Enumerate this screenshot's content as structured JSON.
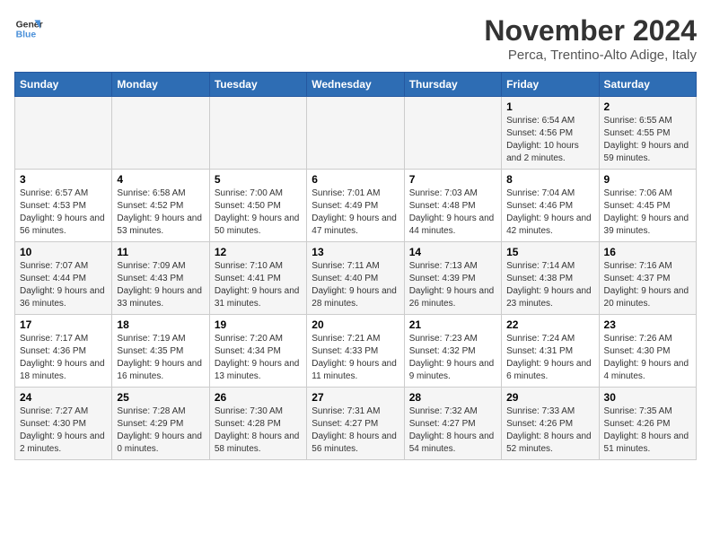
{
  "logo": {
    "line1": "General",
    "line2": "Blue"
  },
  "title": "November 2024",
  "location": "Perca, Trentino-Alto Adige, Italy",
  "headers": [
    "Sunday",
    "Monday",
    "Tuesday",
    "Wednesday",
    "Thursday",
    "Friday",
    "Saturday"
  ],
  "weeks": [
    [
      {
        "day": "",
        "info": ""
      },
      {
        "day": "",
        "info": ""
      },
      {
        "day": "",
        "info": ""
      },
      {
        "day": "",
        "info": ""
      },
      {
        "day": "",
        "info": ""
      },
      {
        "day": "1",
        "info": "Sunrise: 6:54 AM\nSunset: 4:56 PM\nDaylight: 10 hours and 2 minutes."
      },
      {
        "day": "2",
        "info": "Sunrise: 6:55 AM\nSunset: 4:55 PM\nDaylight: 9 hours and 59 minutes."
      }
    ],
    [
      {
        "day": "3",
        "info": "Sunrise: 6:57 AM\nSunset: 4:53 PM\nDaylight: 9 hours and 56 minutes."
      },
      {
        "day": "4",
        "info": "Sunrise: 6:58 AM\nSunset: 4:52 PM\nDaylight: 9 hours and 53 minutes."
      },
      {
        "day": "5",
        "info": "Sunrise: 7:00 AM\nSunset: 4:50 PM\nDaylight: 9 hours and 50 minutes."
      },
      {
        "day": "6",
        "info": "Sunrise: 7:01 AM\nSunset: 4:49 PM\nDaylight: 9 hours and 47 minutes."
      },
      {
        "day": "7",
        "info": "Sunrise: 7:03 AM\nSunset: 4:48 PM\nDaylight: 9 hours and 44 minutes."
      },
      {
        "day": "8",
        "info": "Sunrise: 7:04 AM\nSunset: 4:46 PM\nDaylight: 9 hours and 42 minutes."
      },
      {
        "day": "9",
        "info": "Sunrise: 7:06 AM\nSunset: 4:45 PM\nDaylight: 9 hours and 39 minutes."
      }
    ],
    [
      {
        "day": "10",
        "info": "Sunrise: 7:07 AM\nSunset: 4:44 PM\nDaylight: 9 hours and 36 minutes."
      },
      {
        "day": "11",
        "info": "Sunrise: 7:09 AM\nSunset: 4:43 PM\nDaylight: 9 hours and 33 minutes."
      },
      {
        "day": "12",
        "info": "Sunrise: 7:10 AM\nSunset: 4:41 PM\nDaylight: 9 hours and 31 minutes."
      },
      {
        "day": "13",
        "info": "Sunrise: 7:11 AM\nSunset: 4:40 PM\nDaylight: 9 hours and 28 minutes."
      },
      {
        "day": "14",
        "info": "Sunrise: 7:13 AM\nSunset: 4:39 PM\nDaylight: 9 hours and 26 minutes."
      },
      {
        "day": "15",
        "info": "Sunrise: 7:14 AM\nSunset: 4:38 PM\nDaylight: 9 hours and 23 minutes."
      },
      {
        "day": "16",
        "info": "Sunrise: 7:16 AM\nSunset: 4:37 PM\nDaylight: 9 hours and 20 minutes."
      }
    ],
    [
      {
        "day": "17",
        "info": "Sunrise: 7:17 AM\nSunset: 4:36 PM\nDaylight: 9 hours and 18 minutes."
      },
      {
        "day": "18",
        "info": "Sunrise: 7:19 AM\nSunset: 4:35 PM\nDaylight: 9 hours and 16 minutes."
      },
      {
        "day": "19",
        "info": "Sunrise: 7:20 AM\nSunset: 4:34 PM\nDaylight: 9 hours and 13 minutes."
      },
      {
        "day": "20",
        "info": "Sunrise: 7:21 AM\nSunset: 4:33 PM\nDaylight: 9 hours and 11 minutes."
      },
      {
        "day": "21",
        "info": "Sunrise: 7:23 AM\nSunset: 4:32 PM\nDaylight: 9 hours and 9 minutes."
      },
      {
        "day": "22",
        "info": "Sunrise: 7:24 AM\nSunset: 4:31 PM\nDaylight: 9 hours and 6 minutes."
      },
      {
        "day": "23",
        "info": "Sunrise: 7:26 AM\nSunset: 4:30 PM\nDaylight: 9 hours and 4 minutes."
      }
    ],
    [
      {
        "day": "24",
        "info": "Sunrise: 7:27 AM\nSunset: 4:30 PM\nDaylight: 9 hours and 2 minutes."
      },
      {
        "day": "25",
        "info": "Sunrise: 7:28 AM\nSunset: 4:29 PM\nDaylight: 9 hours and 0 minutes."
      },
      {
        "day": "26",
        "info": "Sunrise: 7:30 AM\nSunset: 4:28 PM\nDaylight: 8 hours and 58 minutes."
      },
      {
        "day": "27",
        "info": "Sunrise: 7:31 AM\nSunset: 4:27 PM\nDaylight: 8 hours and 56 minutes."
      },
      {
        "day": "28",
        "info": "Sunrise: 7:32 AM\nSunset: 4:27 PM\nDaylight: 8 hours and 54 minutes."
      },
      {
        "day": "29",
        "info": "Sunrise: 7:33 AM\nSunset: 4:26 PM\nDaylight: 8 hours and 52 minutes."
      },
      {
        "day": "30",
        "info": "Sunrise: 7:35 AM\nSunset: 4:26 PM\nDaylight: 8 hours and 51 minutes."
      }
    ]
  ]
}
